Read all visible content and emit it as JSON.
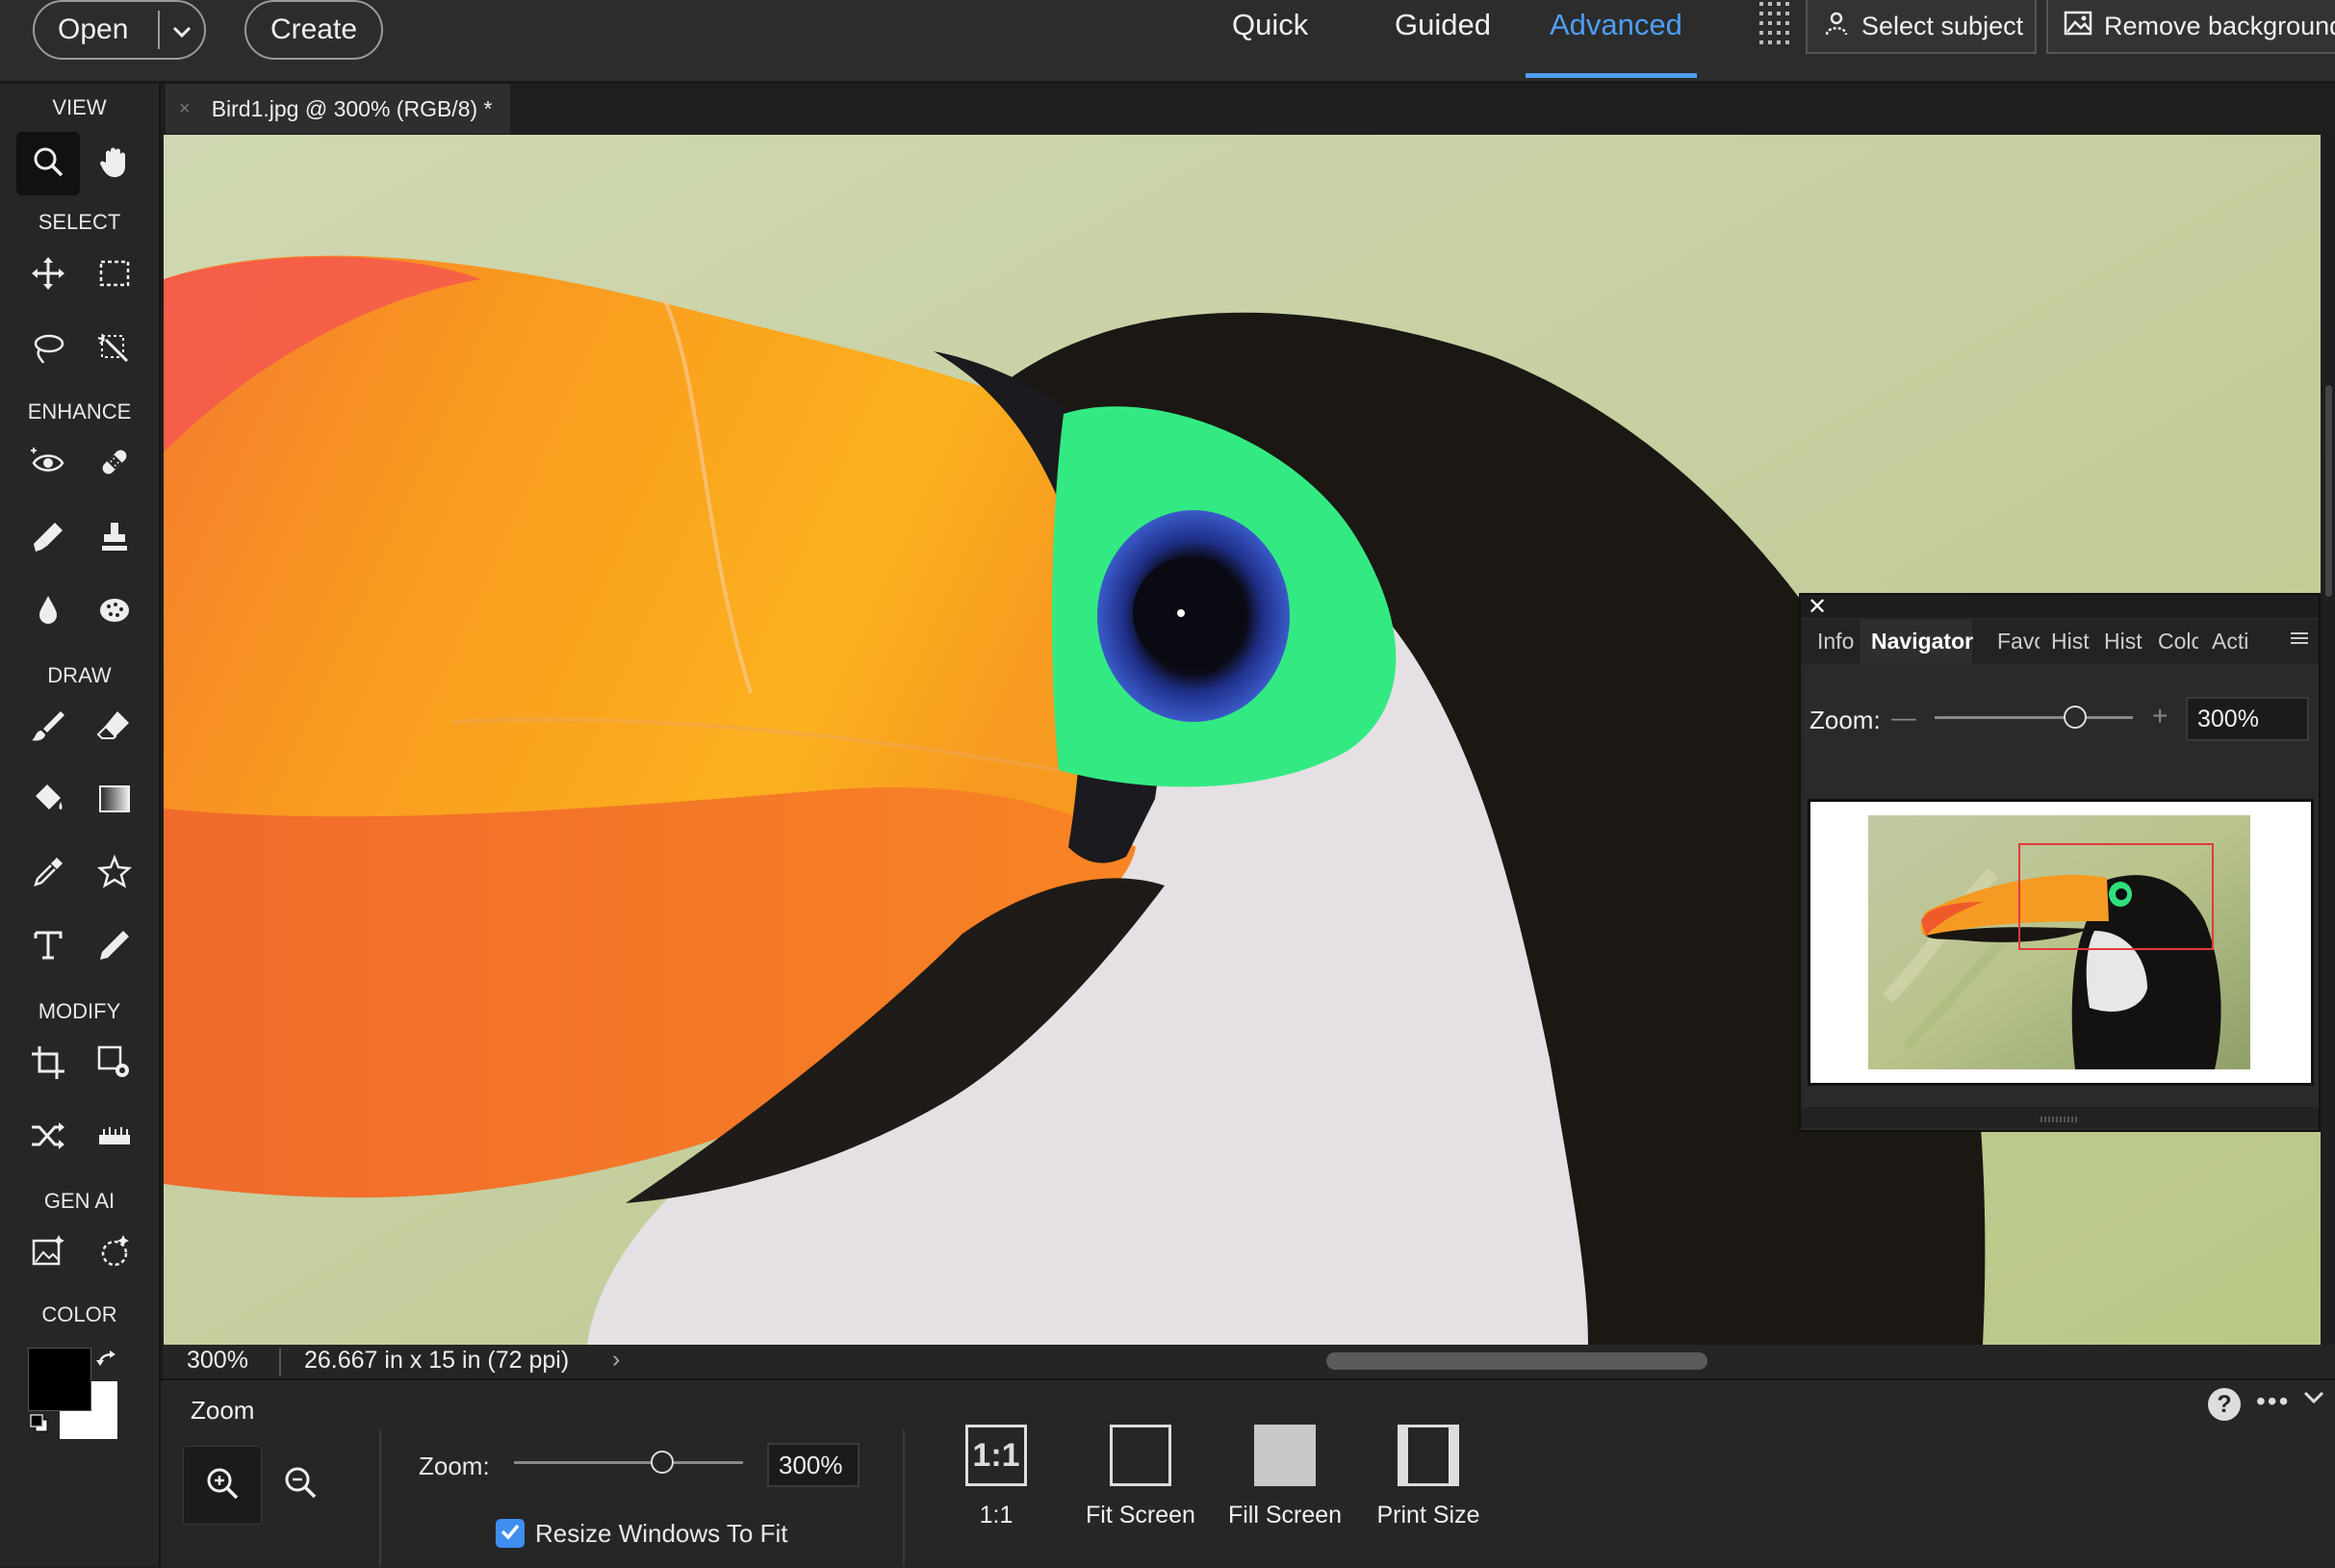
{
  "topbar": {
    "open_label": "Open",
    "create_label": "Create",
    "modes": [
      "Quick",
      "Guided",
      "Advanced"
    ],
    "active_mode": "Advanced",
    "select_subject_label": "Select subject",
    "remove_background_label": "Remove background"
  },
  "toolbar": {
    "sections": {
      "view": "VIEW",
      "select": "SELECT",
      "enhance": "ENHANCE",
      "draw": "DRAW",
      "modify": "MODIFY",
      "gen_ai": "GEN AI",
      "color": "COLOR"
    },
    "active_tool": "zoom",
    "foreground_color": "#000000",
    "background_color": "#ffffff"
  },
  "document": {
    "tab_title": "Bird1.jpg @ 300% (RGB/8) *"
  },
  "status": {
    "zoom": "300%",
    "doc_size": "26.667 in x 15 in (72 ppi)"
  },
  "tool_options": {
    "title": "Zoom",
    "zoom_label": "Zoom:",
    "zoom_value": "300%",
    "resize_windows_label": "Resize Windows To Fit",
    "resize_windows_checked": true,
    "buttons": {
      "one_to_one_icon_text": "1:1",
      "one_to_one": "1:1",
      "fit_screen": "Fit Screen",
      "fill_screen": "Fill Screen",
      "print_size": "Print Size"
    },
    "help_label": "?",
    "more_label": "•••"
  },
  "navigator": {
    "tabs": [
      "Info",
      "Navigator",
      "Favc",
      "Hist",
      "Hist",
      "Colc",
      "Acti"
    ],
    "active_tab": "Navigator",
    "close_label": "✕",
    "zoom_label": "Zoom:",
    "zoom_value": "300%"
  },
  "colors": {
    "accent": "#4e9ef5",
    "checkbox": "#3f8ef0",
    "nav_view_rect": "#e03c3c"
  }
}
